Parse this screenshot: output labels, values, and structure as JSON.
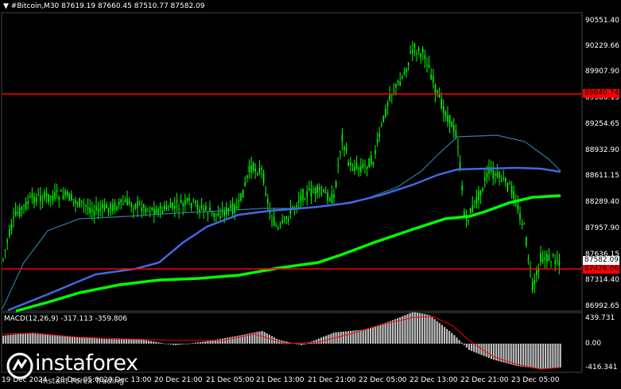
{
  "header": {
    "marker": "▼",
    "symbol_line": "#Bitcoin,M30  87619.19 87660.45 87510.77 87582.09"
  },
  "price_axis": {
    "ticks": [
      "90551.40",
      "90229.66",
      "89907.90",
      "89586.15",
      "89254.65",
      "88932.90",
      "88611.15",
      "88289.40",
      "87957.90",
      "87636.15",
      "87314.40",
      "86992.65"
    ],
    "red_labels": [
      "89640.74",
      "87476.06"
    ],
    "current_label": "87582.09"
  },
  "macd": {
    "title": "MACD(12,26,9) -317.113 -359.806",
    "ticks": [
      "439.731",
      "0.00",
      "-416.341"
    ]
  },
  "time_axis": {
    "labels": [
      "19 Dec 2024",
      "20 Dec 05:00",
      "20 Dec 13:00",
      "20 Dec 21:00",
      "21 Dec 05:00",
      "21 Dec 13:00",
      "21 Dec 21:00",
      "22 Dec 05:00",
      "22 Dec 13:00",
      "22 Dec 21:00",
      "23 Dec 05:00"
    ]
  },
  "watermark": {
    "brand": "instaforex",
    "tagline": "Instant Forex Trading",
    "icon": "instaforex-logo-icon"
  },
  "colors": {
    "background": "#000000",
    "candles": "#00ff00",
    "horizontal_lines": "#ff0000",
    "ma_fast": "#2a7f9f",
    "ma_mid": "#4169e1",
    "ma_slow": "#00ff00",
    "macd_hist": "#c0c0c0",
    "macd_signal": "#ff0000"
  }
}
